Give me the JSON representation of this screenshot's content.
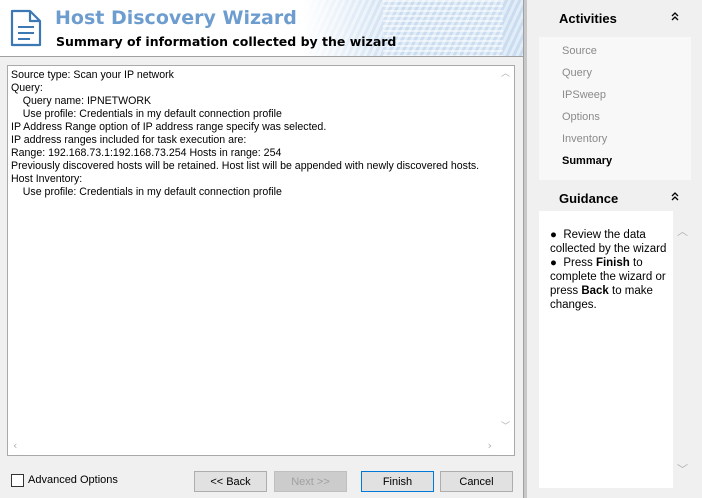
{
  "wizard": {
    "title": "Host Discovery Wizard",
    "subtitle": "Summary of information collected by the wizard"
  },
  "summary_lines": [
    "Source type: Scan your IP network",
    "Query:",
    "    Query name: IPNETWORK",
    "    Use profile: Credentials in my default connection profile",
    "IP Address Range option of IP address range specify was selected.",
    "IP address ranges included for task execution are:",
    "Range: 192.168.73.1:192.168.73.254 Hosts in range: 254",
    "Previously discovered hosts will be retained. Host list will be appended with newly discovered hosts.",
    "Host Inventory:",
    "    Use profile: Credentials in my default connection profile"
  ],
  "bottom": {
    "advanced_options_label": "Advanced Options",
    "advanced_options_checked": false,
    "back_label": "<< Back",
    "next_label": "Next >>",
    "finish_label": "Finish",
    "cancel_label": "Cancel"
  },
  "activities": {
    "title": "Activities",
    "items": [
      {
        "label": "Source",
        "current": false
      },
      {
        "label": "Query",
        "current": false
      },
      {
        "label": "IPSweep",
        "current": false
      },
      {
        "label": "Options",
        "current": false
      },
      {
        "label": "Inventory",
        "current": false
      },
      {
        "label": "Summary",
        "current": true
      }
    ]
  },
  "guidance": {
    "title": "Guidance",
    "bullet1": "Review the data collected by the wizard",
    "bullet2_pre": "Press ",
    "bullet2_finish": "Finish",
    "bullet2_mid": " to complete the wizard or press ",
    "bullet2_back": "Back",
    "bullet2_post": " to make changes."
  },
  "icons": {
    "wizard": "document-icon",
    "collapse": "double-chevron-up-icon"
  },
  "colors": {
    "title": "#6d9ccf",
    "panel_bg": "#f0f0f0",
    "finish_border": "#0078d7"
  }
}
